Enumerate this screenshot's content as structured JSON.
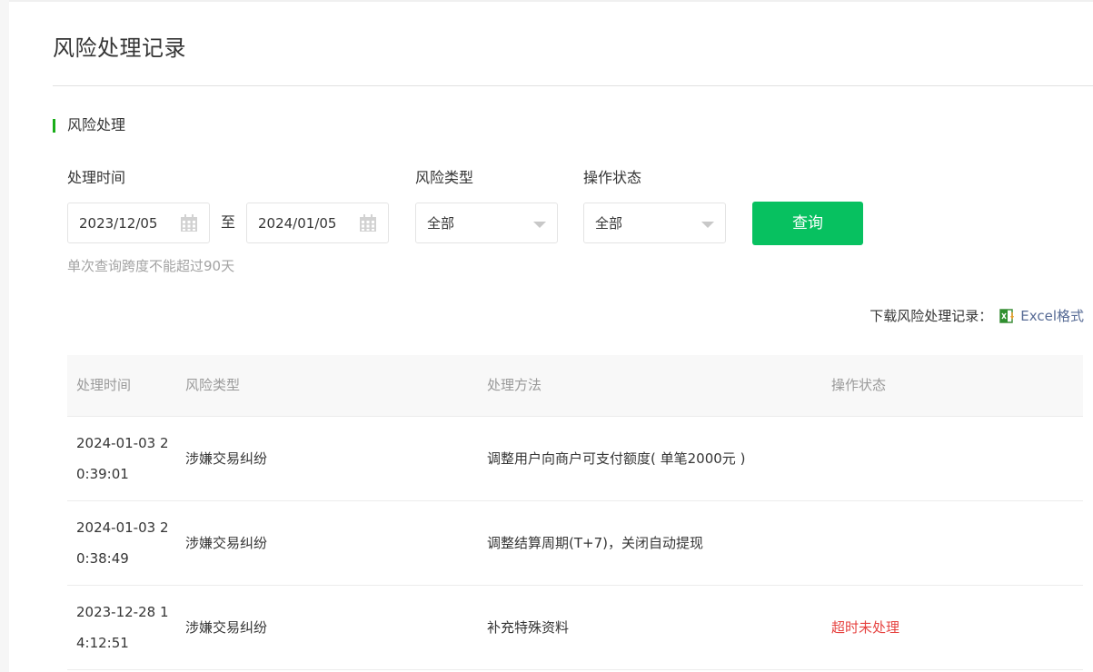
{
  "page": {
    "title": "风险处理记录",
    "section_title": "风险处理"
  },
  "filters": {
    "time_label": "处理时间",
    "start_date": "2023/12/05",
    "to_label": "至",
    "end_date": "2024/01/05",
    "risk_type_label": "风险类型",
    "risk_type_value": "全部",
    "status_label": "操作状态",
    "status_value": "全部",
    "query_button": "查询",
    "hint": "单次查询跨度不能超过90天"
  },
  "download": {
    "label": "下载风险处理记录：",
    "link": "Excel格式",
    "icon": "excel-icon"
  },
  "table": {
    "headers": [
      "处理时间",
      "风险类型",
      "处理方法",
      "操作状态"
    ],
    "rows": [
      {
        "time": "2024-01-03 20:39:01",
        "type": "涉嫌交易纠纷",
        "method": "调整用户向商户可支付额度( 单笔2000元 )",
        "status": ""
      },
      {
        "time": "2024-01-03 20:38:49",
        "type": "涉嫌交易纠纷",
        "method": "调整结算周期(T+7)，关闭自动提现",
        "status": ""
      },
      {
        "time": "2023-12-28 14:12:51",
        "type": "涉嫌交易纠纷",
        "method": "补充特殊资料",
        "status": "超时未处理"
      }
    ]
  },
  "colors": {
    "accent": "#07c160",
    "section_bar": "#1aad19",
    "link": "#576b95",
    "warning": "#e64340"
  }
}
